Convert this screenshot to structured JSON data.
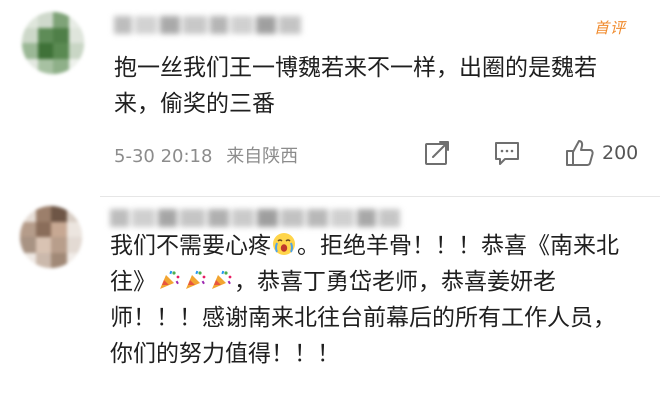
{
  "comments": [
    {
      "badge": "首评",
      "content": "抱一丝我们王一博魏若来不一样，出圈的是魏若来，偷奖的三番",
      "date": "5-30 20:18",
      "location": "来自陕西",
      "like_count": "200"
    },
    {
      "content_parts": [
        "我们不需要心疼",
        "。拒绝羊骨！！！恭喜《南来北往》",
        "，恭喜丁勇岱老师，恭喜姜妍老师！！！感谢南来北往台前幕后的所有工作人员，你们的努力值得！！！"
      ]
    }
  ],
  "icons": {
    "share": "share-icon",
    "comment": "comment-icon",
    "like": "thumbs-up-icon",
    "emoji_sad": "crying-face-emoji-icon",
    "emoji_party": "party-popper-emoji-icon"
  },
  "colors": {
    "badge": "#f08a2c",
    "text": "#1f1f1f",
    "meta": "#8c8c8c"
  }
}
